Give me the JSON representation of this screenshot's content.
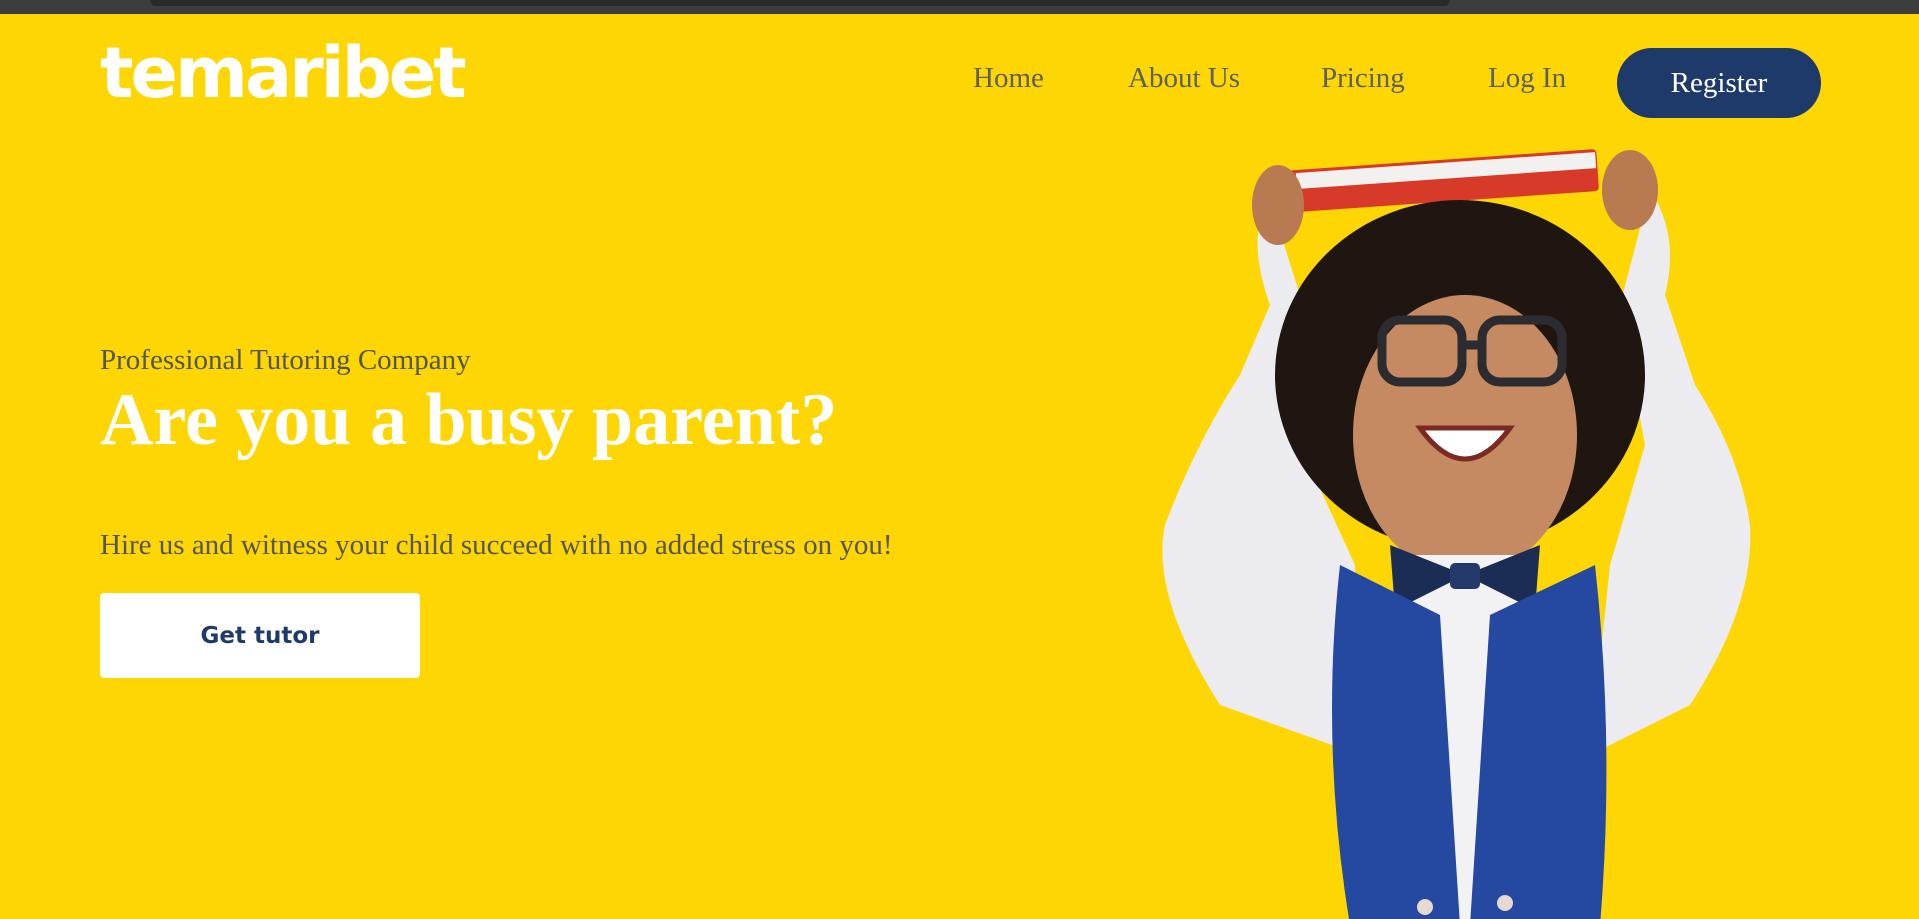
{
  "brand": {
    "logo_text": "temaribet"
  },
  "nav": {
    "items": [
      {
        "label": "Home"
      },
      {
        "label": "About Us"
      },
      {
        "label": "Pricing"
      },
      {
        "label": "Log In"
      }
    ],
    "register_label": "Register"
  },
  "hero": {
    "eyebrow": "Professional Tutoring Company",
    "headline": "Are you a busy parent?",
    "subtext": "Hire us and witness your child succeed with no added stress on you!",
    "cta_label": "Get tutor",
    "image_icon": "child-with-book-photo"
  },
  "colors": {
    "background": "#FDD604",
    "accent": "#1E3A6B",
    "text_muted": "#555555",
    "white": "#FFFFFF"
  }
}
